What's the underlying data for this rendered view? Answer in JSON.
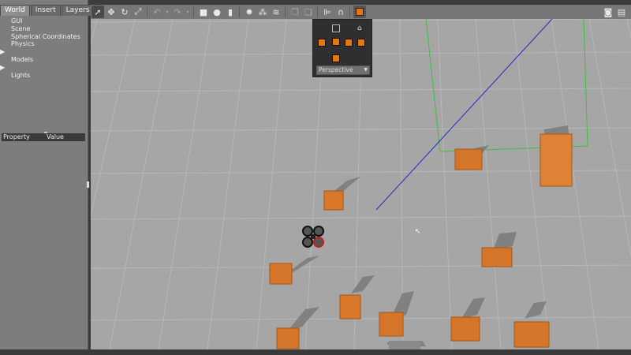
{
  "tabs": [
    {
      "label": "World",
      "active": true
    },
    {
      "label": "Insert",
      "active": false
    },
    {
      "label": "Layers",
      "active": false
    }
  ],
  "world_tree": [
    {
      "label": "GUI",
      "expandable": false
    },
    {
      "label": "Scene",
      "expandable": false
    },
    {
      "label": "Spherical Coordinates",
      "expandable": false
    },
    {
      "label": "Physics",
      "expandable": false
    },
    {
      "label": "Models",
      "expandable": true
    },
    {
      "label": "Lights",
      "expandable": true
    }
  ],
  "properties": {
    "col_property": "Property",
    "col_value": "Value"
  },
  "toolbar": {
    "icons": [
      "select-arrow-icon",
      "translate-icon",
      "rotate-icon",
      "scale-icon",
      "undo-icon",
      "redo-icon",
      "box-icon",
      "sphere-icon",
      "cylinder-icon",
      "sun-light-icon",
      "point-light-icon",
      "spot-light-icon",
      "copy-icon",
      "paste-icon",
      "align-icon",
      "snap-icon",
      "camera-view-icon",
      "screenshot-icon",
      "record-icon"
    ]
  },
  "view_popup": {
    "projection": "Perspective"
  },
  "colors": {
    "accent_orange": "#e8760a",
    "viewport_bg": "#a6a6a6",
    "grid_line": "#b8b8b8"
  }
}
